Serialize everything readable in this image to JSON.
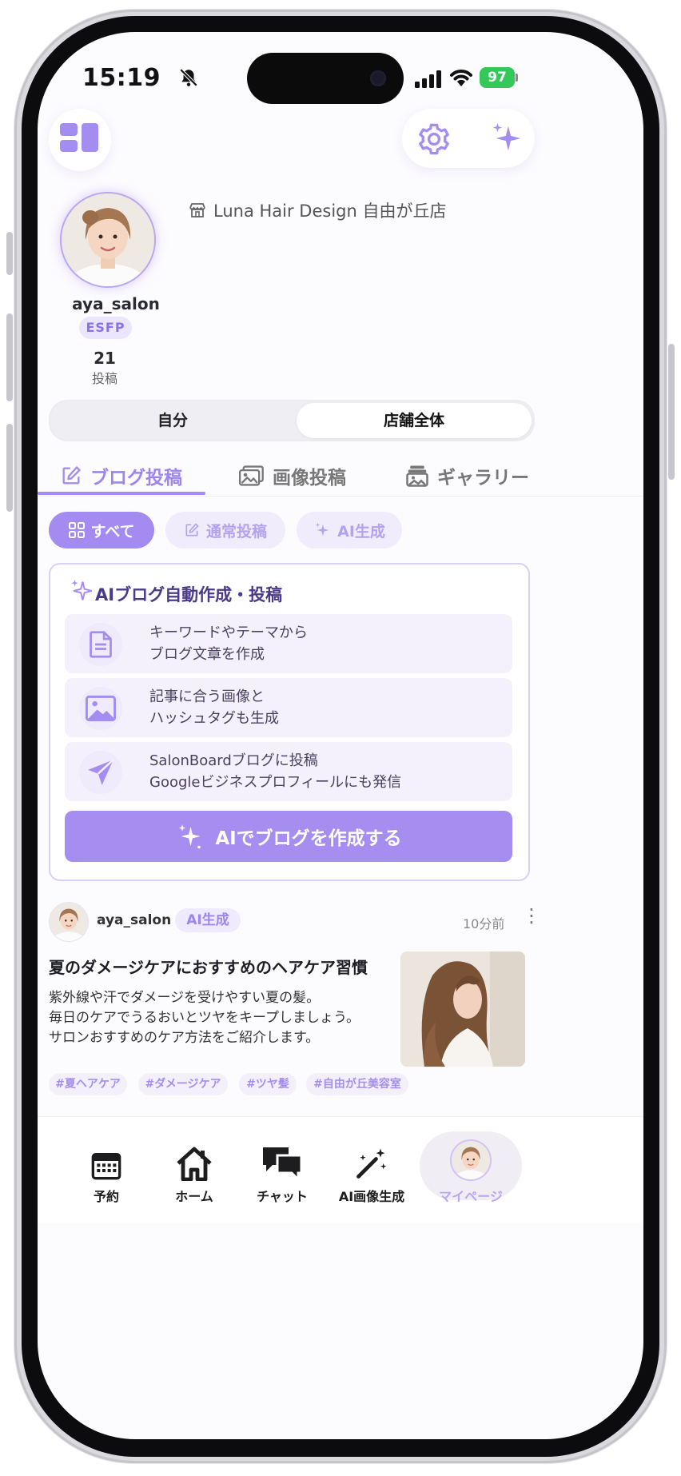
{
  "status": {
    "time": "15:19",
    "battery": "97"
  },
  "colors": {
    "accent": "#a68df0",
    "accent_light": "#efeafd",
    "battery": "#34c759"
  },
  "header": {
    "left_icon": "dashboard-grid-icon",
    "settings_icon": "gear-icon",
    "ai_icon": "sparkles-icon"
  },
  "profile": {
    "username": "aya_salon",
    "mbti": "ESFP",
    "post_count": "21",
    "post_count_label": "投稿",
    "shop_name": "Luna Hair Design 自由が丘店"
  },
  "segment": {
    "self": "自分",
    "store_all": "店舗全体"
  },
  "tabs": [
    {
      "label": "ブログ投稿",
      "icon": "edit-icon",
      "active": true
    },
    {
      "label": "画像投稿",
      "icon": "image-icon",
      "active": false
    },
    {
      "label": "ギャラリー",
      "icon": "gallery-icon",
      "active": false
    }
  ],
  "filters": [
    {
      "label": "すべて",
      "icon": "grid-icon",
      "selected": true
    },
    {
      "label": "通常投稿",
      "icon": "edit-icon",
      "selected": false
    },
    {
      "label": "AI生成",
      "icon": "sparkles-icon",
      "selected": false
    }
  ],
  "ai_card": {
    "title": "AIブログ自動作成・投稿",
    "features": [
      {
        "icon": "document-icon",
        "text": "キーワードやテーマから\nブログ文章を作成"
      },
      {
        "icon": "image-icon",
        "text": "記事に合う画像と\nハッシュタグも生成"
      },
      {
        "icon": "send-icon",
        "text": "SalonBoardブログに投稿\nGoogleビジネスプロフィールにも発信"
      }
    ],
    "button_label": "AIでブログを作成する"
  },
  "post": {
    "username": "aya_salon",
    "badge": "AI生成",
    "time": "10分前",
    "more": "⋮",
    "title": "夏のダメージケアにおすすめのヘアケア習慣",
    "body": "紫外線や汗でダメージを受けやすい夏の髪。\n毎日のケアでうるおいとツヤをキープしましょう。\nサロンおすすめのケア方法をご紹介します。",
    "tags": [
      "#夏ヘアケア",
      "#ダメージケア",
      "#ツヤ髪",
      "#自由が丘美容室"
    ]
  },
  "nav": {
    "items": [
      {
        "label": "予約",
        "icon": "calendar-icon"
      },
      {
        "label": "ホーム",
        "icon": "home-icon"
      },
      {
        "label": "チャット",
        "icon": "chat-icon"
      },
      {
        "label": "AI画像生成",
        "icon": "magic-wand-icon"
      },
      {
        "label": "マイページ",
        "icon": "avatar",
        "active": true
      }
    ]
  }
}
